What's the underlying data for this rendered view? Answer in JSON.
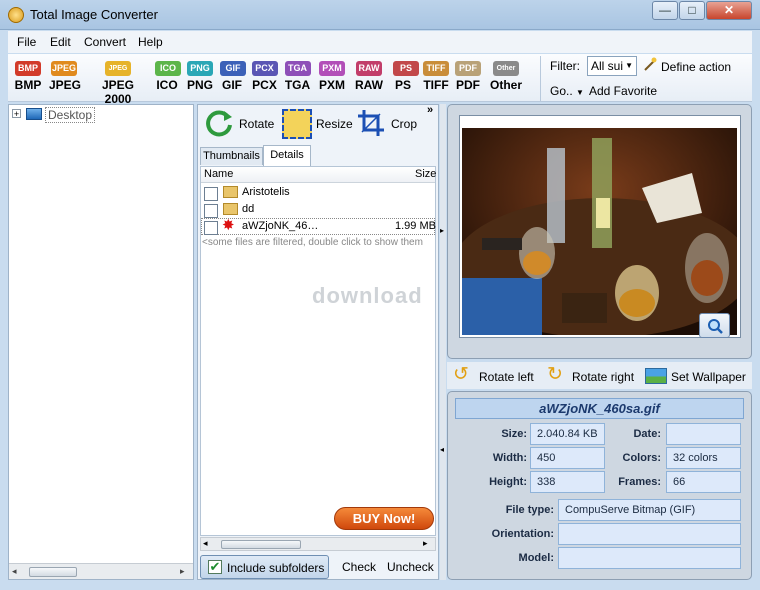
{
  "window": {
    "title": "Total Image Converter"
  },
  "menu": [
    "File",
    "Edit",
    "Convert",
    "Help"
  ],
  "formats": [
    {
      "label": "BMP",
      "icon_text": "BMP",
      "color": "#d23b2a"
    },
    {
      "label": "JPEG",
      "icon_text": "JPEG",
      "color": "#e08a1e"
    },
    {
      "label": "JPEG 2000",
      "icon_text": "JPEG 2000",
      "color": "#e6b32a"
    },
    {
      "label": "ICO",
      "icon_text": "ICO",
      "color": "#5cb54a"
    },
    {
      "label": "PNG",
      "icon_text": "PNG",
      "color": "#2aa7b6"
    },
    {
      "label": "GIF",
      "icon_text": "GIF",
      "color": "#3c61b8"
    },
    {
      "label": "PCX",
      "icon_text": "PCX",
      "color": "#5b56b4"
    },
    {
      "label": "TGA",
      "icon_text": "TGA",
      "color": "#8e4fb8"
    },
    {
      "label": "PXM",
      "icon_text": "PXM",
      "color": "#b24fb8"
    },
    {
      "label": "RAW",
      "icon_text": "RAW",
      "color": "#c23e6a"
    },
    {
      "label": "PS",
      "icon_text": "PS",
      "color": "#c2484a"
    },
    {
      "label": "TIFF",
      "icon_text": "TIFF",
      "color": "#c98d3a"
    },
    {
      "label": "PDF",
      "icon_text": "PDF",
      "color": "#b9a278"
    },
    {
      "label": "Other",
      "icon_text": "Other",
      "color": "#8a8a8a"
    }
  ],
  "filter": {
    "label": "Filter:",
    "value": "All sui",
    "define_action": "Define action",
    "go": "Go..",
    "add_favorite": "Add Favorite"
  },
  "tree": {
    "root": "Desktop"
  },
  "actions": {
    "rotate": "Rotate",
    "resize": "Resize",
    "crop": "Crop"
  },
  "tabs": {
    "thumbnails": "Thumbnails",
    "details": "Details"
  },
  "columns": {
    "name": "Name",
    "size": "Size"
  },
  "files": [
    {
      "name": "Aristotelis",
      "size": "",
      "icon": "folder-user-icon"
    },
    {
      "name": "dd",
      "size": "",
      "icon": "folder-icon"
    },
    {
      "name": "aWZjoNK_46…",
      "size": "1.99 MB",
      "icon": "gif-file-icon"
    }
  ],
  "filtered_note": "<some files are filtered, double click to show them",
  "buy_now": "BUY Now!",
  "bottom": {
    "include_subfolders": "Include subfolders",
    "check": "Check",
    "uncheck": "Uncheck"
  },
  "preview_actions": {
    "rotate_left": "Rotate left",
    "rotate_right": "Rotate right",
    "set_wallpaper": "Set Wallpaper"
  },
  "watermark": "download",
  "info": {
    "file_name": "aWZjoNK_460sa.gif",
    "size_label": "Size:",
    "size": "2.040.84 KB",
    "date_label": "Date:",
    "date": "",
    "width_label": "Width:",
    "width": "450",
    "colors_label": "Colors:",
    "colors": "32 colors",
    "height_label": "Height:",
    "height": "338",
    "frames_label": "Frames:",
    "frames": "66",
    "file_type_label": "File type:",
    "file_type": "CompuServe Bitmap (GIF)",
    "orientation_label": "Orientation:",
    "orientation": "",
    "model_label": "Model:",
    "model": ""
  }
}
